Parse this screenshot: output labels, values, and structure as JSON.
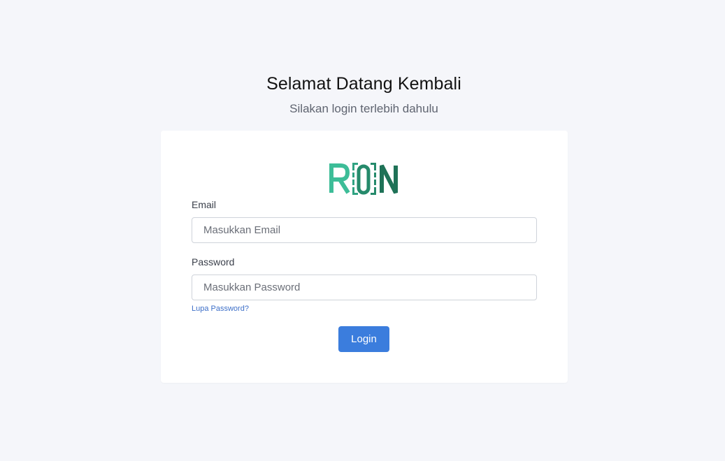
{
  "header": {
    "title": "Selamat Datang Kembali",
    "subtitle": "Silakan login terlebih dahulu"
  },
  "logo": {
    "text": "RON",
    "colors": {
      "light": "#3dbd98",
      "dark": "#1f7257"
    }
  },
  "form": {
    "email_label": "Email",
    "email_placeholder": "Masukkan Email",
    "email_value": "",
    "password_label": "Password",
    "password_placeholder": "Masukkan Password",
    "password_value": "",
    "forgot_link": "Lupa Password?",
    "login_button": "Login"
  },
  "colors": {
    "background": "#f5f6fa",
    "card": "#ffffff",
    "primary": "#3b7ddd",
    "link": "#3d6fc8"
  }
}
